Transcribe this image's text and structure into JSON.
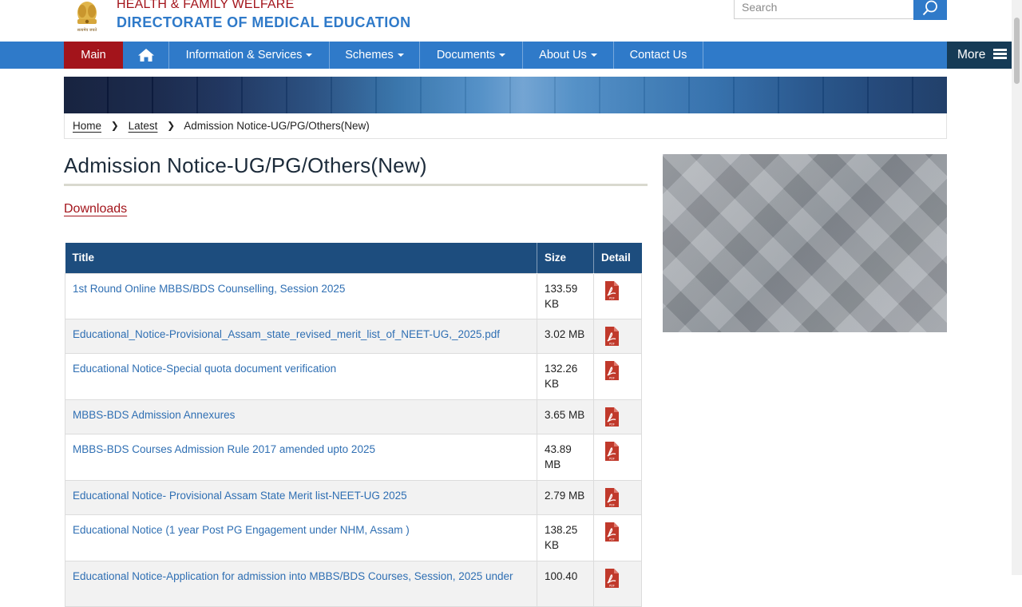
{
  "header": {
    "dept_line1": "HEALTH & FAMILY WELFARE",
    "dept_line2": "DIRECTORATE OF MEDICAL EDUCATION",
    "emblem_caption": "सत्यमेव जयते",
    "search": {
      "placeholder": "Search",
      "value": ""
    },
    "icons": {
      "search": "search-icon",
      "emblem": "state-emblem"
    }
  },
  "nav": {
    "main": "Main",
    "home_icon": "home-icon",
    "items": [
      {
        "label": "Information & Services",
        "dropdown": true
      },
      {
        "label": "Schemes",
        "dropdown": true
      },
      {
        "label": "Documents",
        "dropdown": true
      },
      {
        "label": "About Us",
        "dropdown": true
      },
      {
        "label": "Contact Us",
        "dropdown": false
      }
    ],
    "more": "More",
    "colors": {
      "bar": "#2f7ac9",
      "active": "#a3141b",
      "more": "#163b56"
    }
  },
  "breadcrumb": {
    "home": "Home",
    "latest": "Latest",
    "current": "Admission Notice-UG/PG/Others(New)"
  },
  "page": {
    "title": "Admission Notice-UG/PG/Others(New)",
    "downloads_label": "Downloads"
  },
  "table": {
    "headers": {
      "title": "Title",
      "size": "Size",
      "detail": "Detail"
    },
    "rows": [
      {
        "title": "1st Round Online MBBS/BDS Counselling, Session 2025",
        "size": "133.59 KB"
      },
      {
        "title": "Educational_Notice-Provisional_Assam_state_revised_merit_list_of_NEET-UG,_2025.pdf",
        "size": "3.02 MB"
      },
      {
        "title": "Educational Notice-Special quota document verification",
        "size": "132.26 KB"
      },
      {
        "title": "MBBS-BDS Admission Annexures",
        "size": "3.65 MB"
      },
      {
        "title": "MBBS-BDS Courses Admission Rule 2017 amended upto 2025",
        "size": "43.89 MB"
      },
      {
        "title": "Educational Notice- Provisional Assam State Merit list-NEET-UG 2025",
        "size": "2.79 MB"
      },
      {
        "title": "Educational Notice (1 year Post PG Engagement under NHM, Assam )",
        "size": "138.25 KB"
      },
      {
        "title": "Educational Notice-Application for admission into MBBS/BDS Courses, Session, 2025 under",
        "size": "100.40"
      }
    ],
    "detail_icon": "pdf-icon",
    "colors": {
      "header": "#1d4d7e",
      "link": "#2f6fb3"
    }
  }
}
